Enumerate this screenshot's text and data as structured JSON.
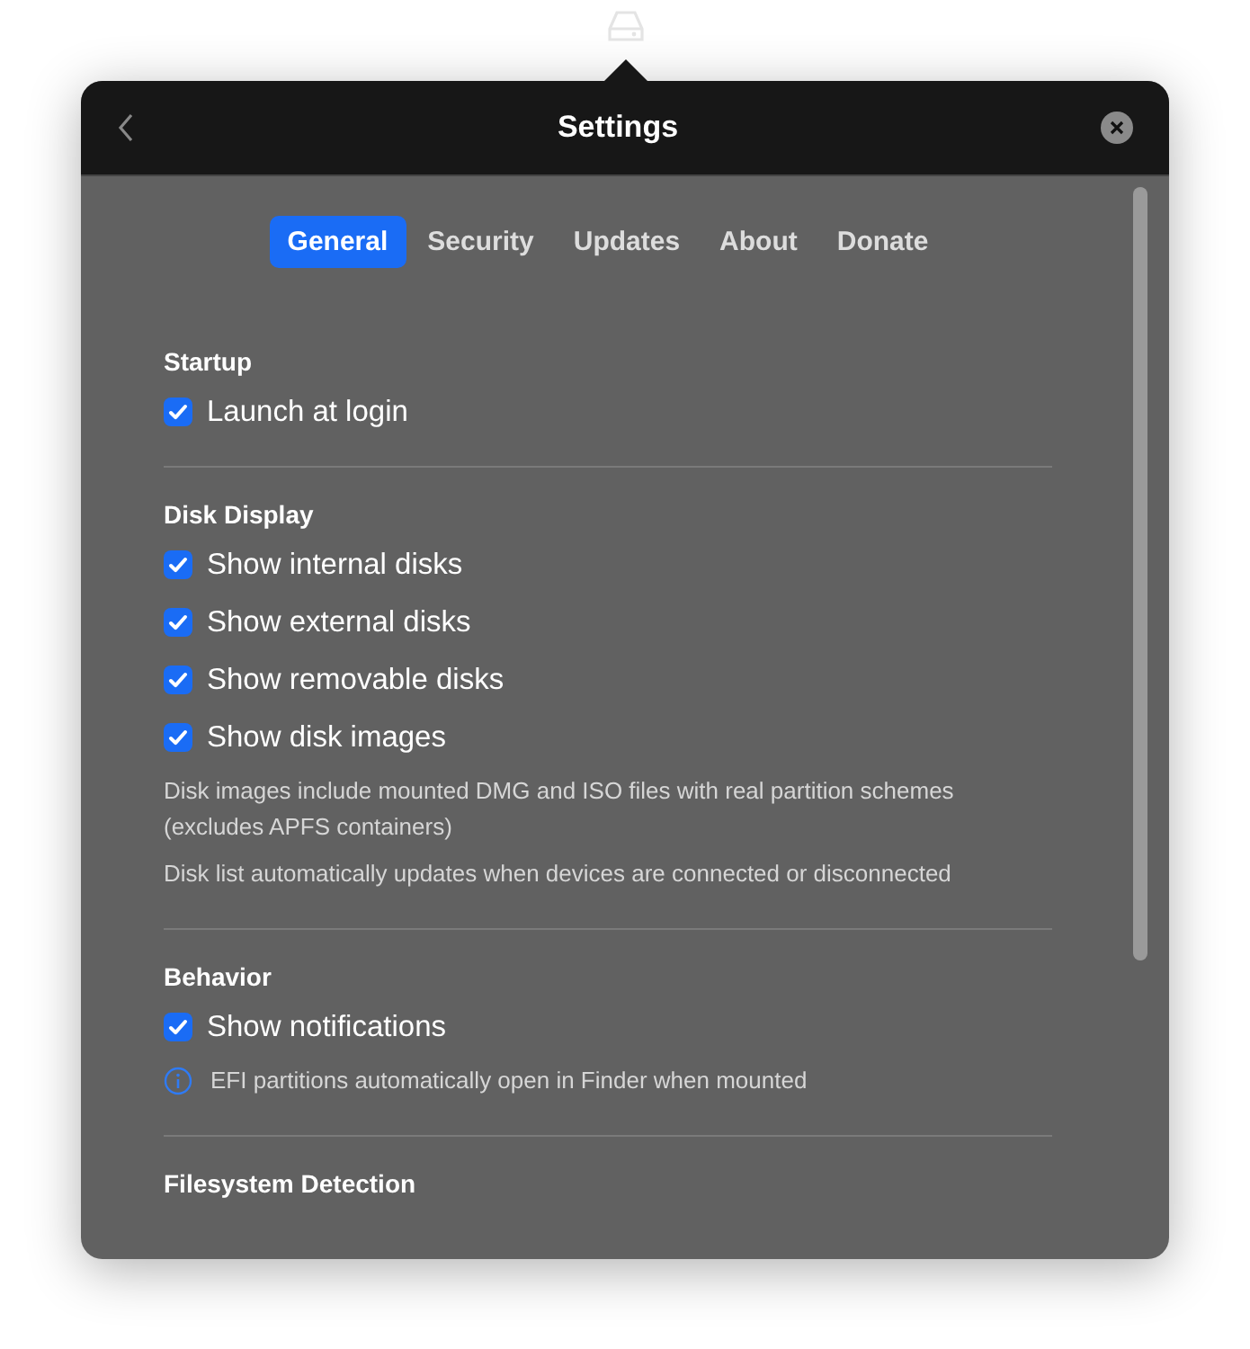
{
  "window": {
    "title": "Settings"
  },
  "tabs": [
    {
      "label": "General",
      "selected": true
    },
    {
      "label": "Security",
      "selected": false
    },
    {
      "label": "Updates",
      "selected": false
    },
    {
      "label": "About",
      "selected": false
    },
    {
      "label": "Donate",
      "selected": false
    }
  ],
  "sections": [
    {
      "title": "Startup",
      "items": [
        {
          "kind": "checkbox",
          "label": "Launch at login",
          "checked": true
        }
      ]
    },
    {
      "title": "Disk Display",
      "items": [
        {
          "kind": "checkbox",
          "label": "Show internal disks",
          "checked": true
        },
        {
          "kind": "checkbox",
          "label": "Show external disks",
          "checked": true
        },
        {
          "kind": "checkbox",
          "label": "Show removable disks",
          "checked": true
        },
        {
          "kind": "checkbox",
          "label": "Show disk images",
          "checked": true
        },
        {
          "kind": "note",
          "text": "Disk images include mounted DMG and ISO files with real partition schemes (excludes APFS containers)"
        },
        {
          "kind": "note",
          "text": "Disk list automatically updates when devices are connected or disconnected"
        }
      ]
    },
    {
      "title": "Behavior",
      "items": [
        {
          "kind": "checkbox",
          "label": "Show notifications",
          "checked": true
        },
        {
          "kind": "info",
          "text": "EFI partitions automatically open in Finder when mounted"
        }
      ]
    },
    {
      "title": "Filesystem Detection"
    }
  ]
}
